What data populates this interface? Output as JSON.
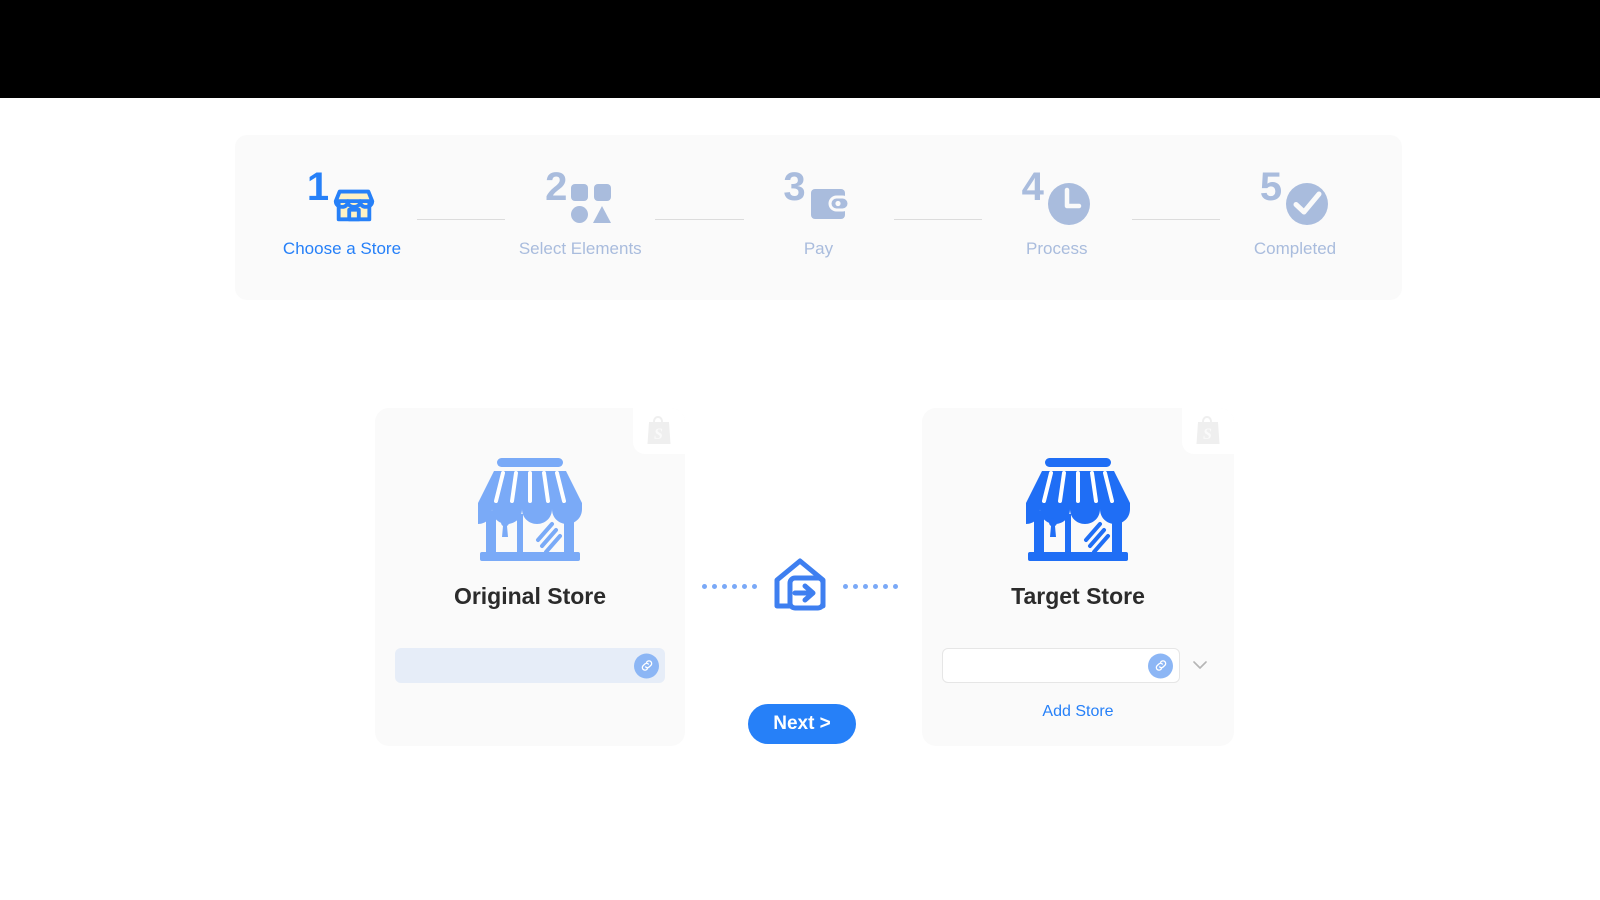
{
  "colors": {
    "accent": "#2680f8",
    "muted": "#a9bcdd",
    "panel_bg": "#fafafa",
    "page_bg": "#ffffff",
    "topbar": "#000000",
    "store_icon_light": "#7aaaf7",
    "store_icon_strong": "#1f6ef5",
    "input_filled_bg": "#e6edf8",
    "link_btn_bg": "#8cb6f5"
  },
  "stepper": {
    "steps": [
      {
        "number": "1",
        "label": "Choose a Store",
        "icon": "storefront-icon",
        "state": "active"
      },
      {
        "number": "2",
        "label": "Select Elements",
        "icon": "shapes-icon",
        "state": "inactive"
      },
      {
        "number": "3",
        "label": "Pay",
        "icon": "wallet-icon",
        "state": "inactive"
      },
      {
        "number": "4",
        "label": "Process",
        "icon": "clock-icon",
        "state": "inactive"
      },
      {
        "number": "5",
        "label": "Completed",
        "icon": "check-circle-icon",
        "state": "inactive"
      }
    ]
  },
  "transfer": {
    "original": {
      "badge_icon": "shopify-bag-icon",
      "store_icon": "storefront-icon",
      "title": "Original Store",
      "input_value": "",
      "input_placeholder": "",
      "link_icon": "link-icon"
    },
    "middle": {
      "icon": "store-transfer-icon",
      "left_dots": 6,
      "right_dots": 6
    },
    "target": {
      "badge_icon": "shopify-bag-icon",
      "store_icon": "storefront-icon",
      "title": "Target Store",
      "input_value": "",
      "input_placeholder": "",
      "link_icon": "link-icon",
      "dropdown_icon": "chevron-down-icon",
      "add_store_label": "Add Store"
    },
    "next_label": "Next >"
  }
}
